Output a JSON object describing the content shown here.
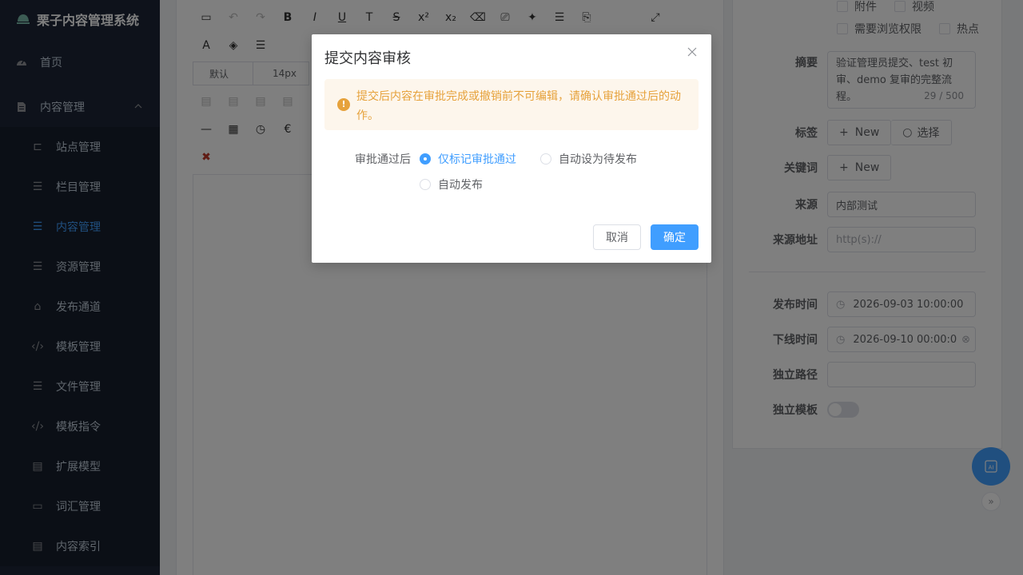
{
  "app": {
    "title": "栗子内容管理系统"
  },
  "sidebar": {
    "items": [
      {
        "label": "首页",
        "icon": "dashboard-icon"
      },
      {
        "label": "内容管理",
        "icon": "document-icon",
        "expanded": true
      }
    ],
    "subitems": [
      {
        "label": "站点管理",
        "icon": "site-icon"
      },
      {
        "label": "栏目管理",
        "icon": "tree-icon"
      },
      {
        "label": "内容管理",
        "icon": "list-icon",
        "active": true
      },
      {
        "label": "资源管理",
        "icon": "list-icon"
      },
      {
        "label": "发布通道",
        "icon": "publish-icon"
      },
      {
        "label": "模板管理",
        "icon": "code-icon"
      },
      {
        "label": "文件管理",
        "icon": "tree-icon"
      },
      {
        "label": "模板指令",
        "icon": "code-icon"
      },
      {
        "label": "扩展模型",
        "icon": "edit-doc-icon"
      },
      {
        "label": "词汇管理",
        "icon": "tag-icon"
      },
      {
        "label": "内容索引",
        "icon": "document-icon"
      }
    ]
  },
  "editor": {
    "font_family": "默认",
    "font_size": "14px"
  },
  "form": {
    "attachment": "附件",
    "video": "视频",
    "need_browse_permission": "需要浏览权限",
    "hot": "热点",
    "summary_label": "摘要",
    "summary_value": "验证管理员提交、test 初审、demo 复审的完整流程。",
    "summary_count": "29 / 500",
    "tags_label": "标签",
    "new_label": "New",
    "select_label": "选择",
    "keywords_label": "关键词",
    "source_label": "来源",
    "source_value": "内部测试",
    "source_url_label": "来源地址",
    "source_url_placeholder": "http(s)://",
    "publish_time_label": "发布时间",
    "publish_time_value": "2026-09-03 10:00:00",
    "offline_time_label": "下线时间",
    "offline_time_value": "2026-09-10 00:00:0",
    "path_label": "独立路径",
    "template_label": "独立模板"
  },
  "dialog": {
    "title": "提交内容审核",
    "alert": "提交后内容在审批完成或撤销前不可编辑，请确认审批通过后的动作。",
    "after_label": "审批通过后",
    "options": [
      {
        "label": "仅标记审批通过",
        "checked": true
      },
      {
        "label": "自动设为待发布",
        "checked": false
      },
      {
        "label": "自动发布",
        "checked": false
      }
    ],
    "cancel": "取消",
    "confirm": "确定"
  },
  "colors": {
    "primary": "#409eff",
    "warning": "#e6a23c",
    "sidebar_bg": "#1c2536"
  }
}
